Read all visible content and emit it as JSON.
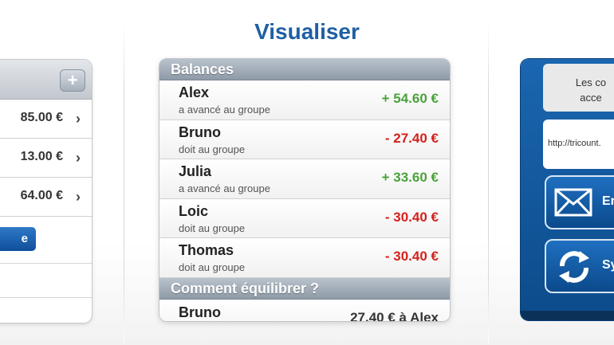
{
  "title": "Visualiser",
  "left_panel": {
    "amounts": [
      "85.00 €",
      "13.00 €",
      "64.00 €"
    ],
    "button_partial": "e",
    "add_button": "+",
    "chevron": "›"
  },
  "balances": {
    "header": "Balances",
    "rows": [
      {
        "name": "Alex",
        "status": "a avancé au groupe",
        "amount": "+ 54.60 €"
      },
      {
        "name": "Bruno",
        "status": "doit au groupe",
        "amount": "- 27.40 €"
      },
      {
        "name": "Julia",
        "status": "a avancé au groupe",
        "amount": "+ 33.60 €"
      },
      {
        "name": "Loic",
        "status": "doit au groupe",
        "amount": "- 30.40 €"
      },
      {
        "name": "Thomas",
        "status": "doit au groupe",
        "amount": "- 30.40 €"
      }
    ]
  },
  "settlement": {
    "header": "Comment équilibrer ?",
    "rows": [
      {
        "name": "Bruno",
        "detail": "27.40 € à Alex"
      }
    ]
  },
  "right_panel": {
    "info_line1": "Les co",
    "info_line2": "acce",
    "url": "http://tricount.",
    "email_label": "Er",
    "sync_label": "Sy"
  },
  "colors": {
    "title": "#1f5fa4",
    "positive": "#4aa23a",
    "negative": "#d3211c",
    "header": "#8e9aa7"
  }
}
